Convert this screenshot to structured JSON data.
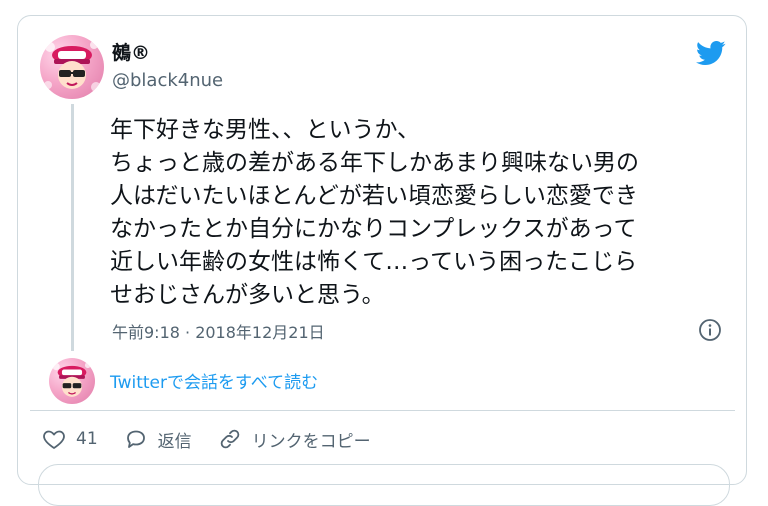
{
  "user": {
    "display_name": "鵺®",
    "handle": "@black4nue",
    "avatar_icon": "user-avatar"
  },
  "tweet": {
    "lines": [
      "年下好きな男性、、というか、",
      "ちょっと歳の差がある年下しかあまり興味ない男の",
      "人はだいたいほとんどが若い頃恋愛らしい恋愛でき",
      "なかったとか自分にかなりコンプレックスがあって",
      "近しい年齢の女性は怖くて…っていう困ったこじら",
      "せおじさんが多いと思う。"
    ],
    "timestamp": "午前9:18 · 2018年12月21日"
  },
  "thread_link": "Twitterで会話をすべて読む",
  "actions": {
    "like_count": "41",
    "reply_label": "返信",
    "copy_link_label": "リンクをコピー"
  },
  "colors": {
    "twitter_blue": "#1d9bf0",
    "text": "#0f1419",
    "secondary": "#536471",
    "border": "#cfd9de"
  }
}
